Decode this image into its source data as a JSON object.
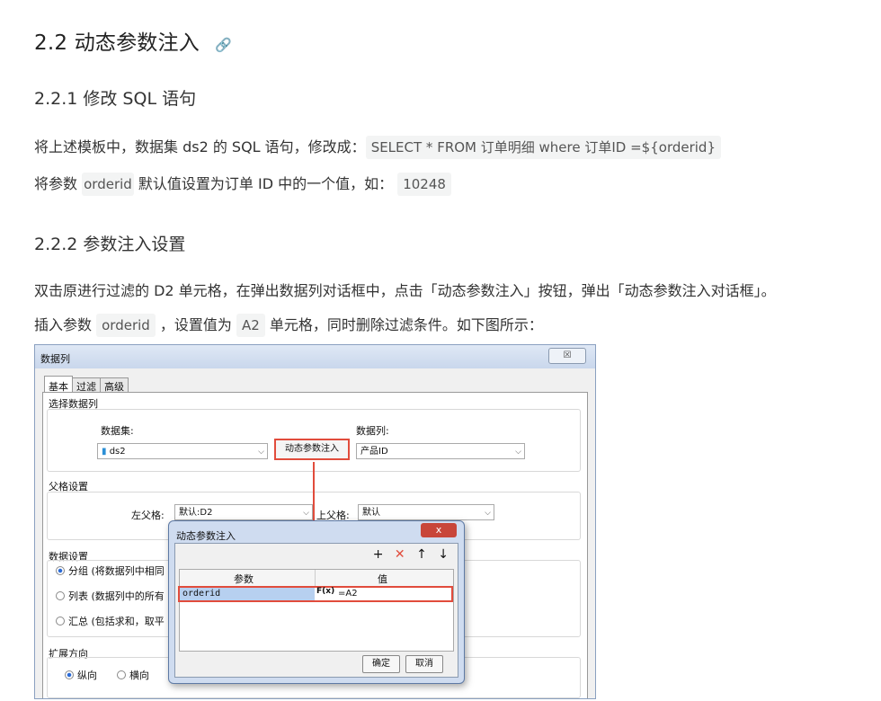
{
  "heading_h2": "2.2 动态参数注入",
  "heading_h2_link_icon": "link-icon",
  "h3_a": "2.2.1 修改 SQL 语句",
  "p1_prefix": "将上述模板中，数据集 ds2 的 SQL 语句，修改成：",
  "p1_code": "SELECT * FROM 订单明细 where 订单ID =${orderid}",
  "p2_a": "将参数",
  "p2_code1": "orderid",
  "p2_b": "默认值设置为订单 ID 中的一个值，如：",
  "p2_code2": "10248",
  "h3_b": "2.2.2 参数注入设置",
  "p3": "双击原进行过滤的 D2 单元格，在弹出数据列对话框中，点击「动态参数注入」按钮，弹出「动态参数注入对话框」。",
  "p4_a": "插入参数",
  "p4_code1": "orderid",
  "p4_b": "，设置值为",
  "p4_code2": "A2",
  "p4_c": "单元格，同时删除过滤条件。如下图所示：",
  "shot": {
    "title": "数据列",
    "close": "☒",
    "tabs": [
      "基本",
      "过滤",
      "高级"
    ],
    "group1": "选择数据列",
    "dataset_label": "数据集:",
    "dataset_value": "ds2",
    "column_label": "数据列:",
    "column_value": "产品ID",
    "inject_button": "动态参数注入",
    "group2": "父格设置",
    "left_parent_label": "左父格:",
    "left_parent_value": "默认:D2",
    "top_parent_label": "上父格:",
    "top_parent_value": "默认",
    "group3": "数据设置",
    "radio1": "分组 (将数据列中相同",
    "radio2": "列表 (数据列中的所有",
    "radio3": "汇总 (包括求和，取平",
    "group4": "扩展方向",
    "dir1": "纵向",
    "dir2": "横向",
    "dialog": {
      "title": "动态参数注入",
      "close": "x",
      "col_param": "参数",
      "col_value": "值",
      "param": "orderid",
      "fx": "F(x)",
      "value": "=A2",
      "ok": "确定",
      "cancel": "取消",
      "tool_add": "+",
      "tool_del": "✕",
      "tool_up": "↑",
      "tool_down": "↓"
    }
  }
}
